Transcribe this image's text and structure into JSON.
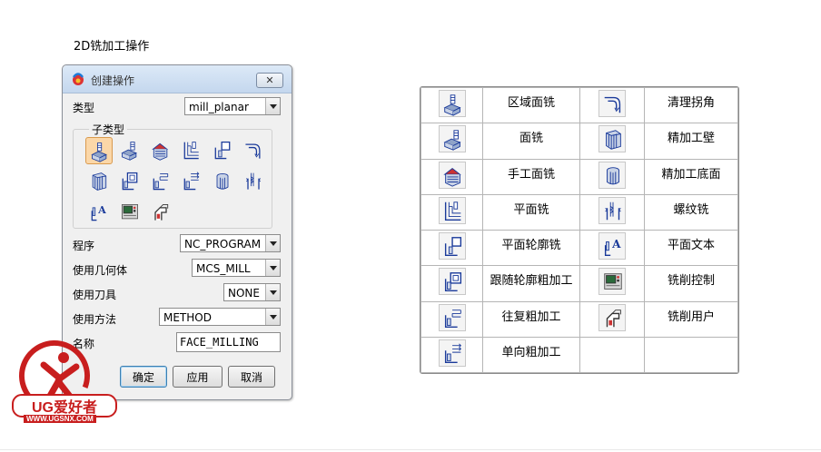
{
  "page": {
    "heading": "2D铣加工操作"
  },
  "dialog": {
    "title": "创建操作",
    "close_label": "✕",
    "type_label": "类型",
    "type_value": "mill_planar",
    "subtype_label": "子类型",
    "subtype_icons": [
      "face-milling-area-icon",
      "face-milling-icon",
      "face-milling-manual-icon",
      "planar-mill-icon",
      "planar-profile-icon",
      "clean-up-corners-icon",
      "finish-walls-icon",
      "rough-follow-icon",
      "rough-zigzag-icon",
      "rough-zig-icon",
      "finish-floor-icon",
      "thread-milling-icon",
      "planar-text-icon",
      "mill-control-icon",
      "mill-user-icon"
    ],
    "fields": {
      "program": {
        "label": "程序",
        "value": "NC_PROGRAM"
      },
      "geometry": {
        "label": "使用几何体",
        "value": "MCS_MILL"
      },
      "tool": {
        "label": "使用刀具",
        "value": "NONE"
      },
      "method": {
        "label": "使用方法",
        "value": "METHOD"
      },
      "name": {
        "label": "名称",
        "value": "FACE_MILLING"
      }
    },
    "buttons": {
      "ok": "确定",
      "apply": "应用",
      "cancel": "取消"
    }
  },
  "reference_table": {
    "rows": [
      {
        "left": {
          "icon": "face-milling-area-icon",
          "name": "区域面铣"
        },
        "right": {
          "icon": "clean-up-corners-icon",
          "name": "清理拐角"
        }
      },
      {
        "left": {
          "icon": "face-milling-icon",
          "name": "面铣"
        },
        "right": {
          "icon": "finish-walls-icon",
          "name": "精加工壁"
        }
      },
      {
        "left": {
          "icon": "face-milling-manual-icon",
          "name": "手工面铣"
        },
        "right": {
          "icon": "finish-floor-icon",
          "name": "精加工底面"
        }
      },
      {
        "left": {
          "icon": "planar-mill-icon",
          "name": "平面铣"
        },
        "right": {
          "icon": "thread-milling-icon",
          "name": "螺纹铣"
        }
      },
      {
        "left": {
          "icon": "planar-profile-icon",
          "name": "平面轮廓铣"
        },
        "right": {
          "icon": "planar-text-icon",
          "name": "平面文本"
        }
      },
      {
        "left": {
          "icon": "rough-follow-icon",
          "name": "跟随轮廓粗加工"
        },
        "right": {
          "icon": "mill-control-icon",
          "name": "铣削控制"
        }
      },
      {
        "left": {
          "icon": "rough-zigzag-icon",
          "name": "往复粗加工"
        },
        "right": {
          "icon": "mill-user-icon",
          "name": "铣削用户"
        }
      },
      {
        "left": {
          "icon": "rough-zig-icon",
          "name": "单向粗加工"
        },
        "right": {
          "icon": "",
          "name": ""
        }
      }
    ]
  },
  "watermark": {
    "brand": "UG爱好者",
    "url": "WWW.UGSNX.COM"
  },
  "colors": {
    "accent": "#c81e1e",
    "selected": "#fbd7a8",
    "icon_blue": "#1a3a9a"
  }
}
